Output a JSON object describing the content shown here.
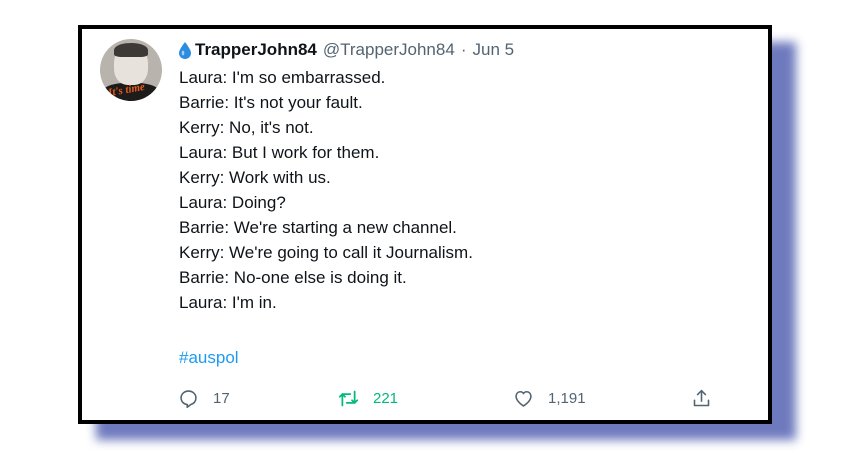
{
  "tweet": {
    "display_name": "TrapperJohn84",
    "handle": "@TrapperJohn84",
    "separator": "·",
    "date": "Jun 5",
    "avatar_text": "It's time",
    "lines": [
      "Laura: I'm so embarrassed.",
      "Barrie: It's not your fault.",
      "Kerry: No, it's not.",
      "Laura: But I work for them.",
      "Kerry: Work with us.",
      "Laura: Doing?",
      "Barrie: We're starting a new channel.",
      "Kerry: We're going to call it Journalism.",
      "Barrie: No-one else is doing it.",
      "Laura: I'm in."
    ],
    "hashtag": "#auspol"
  },
  "actions": {
    "reply_count": "17",
    "retweet_count": "221",
    "like_count": "1,191"
  },
  "icons": {
    "name_emoji": "droplet-icon",
    "reply": "reply-icon",
    "retweet": "retweet-icon",
    "like": "heart-icon",
    "share": "share-icon"
  },
  "colors": {
    "link": "#1d9bf0",
    "retweet": "#00ba7c",
    "muted": "#536471",
    "text": "#0f1419",
    "shadow": "#5563b3"
  }
}
